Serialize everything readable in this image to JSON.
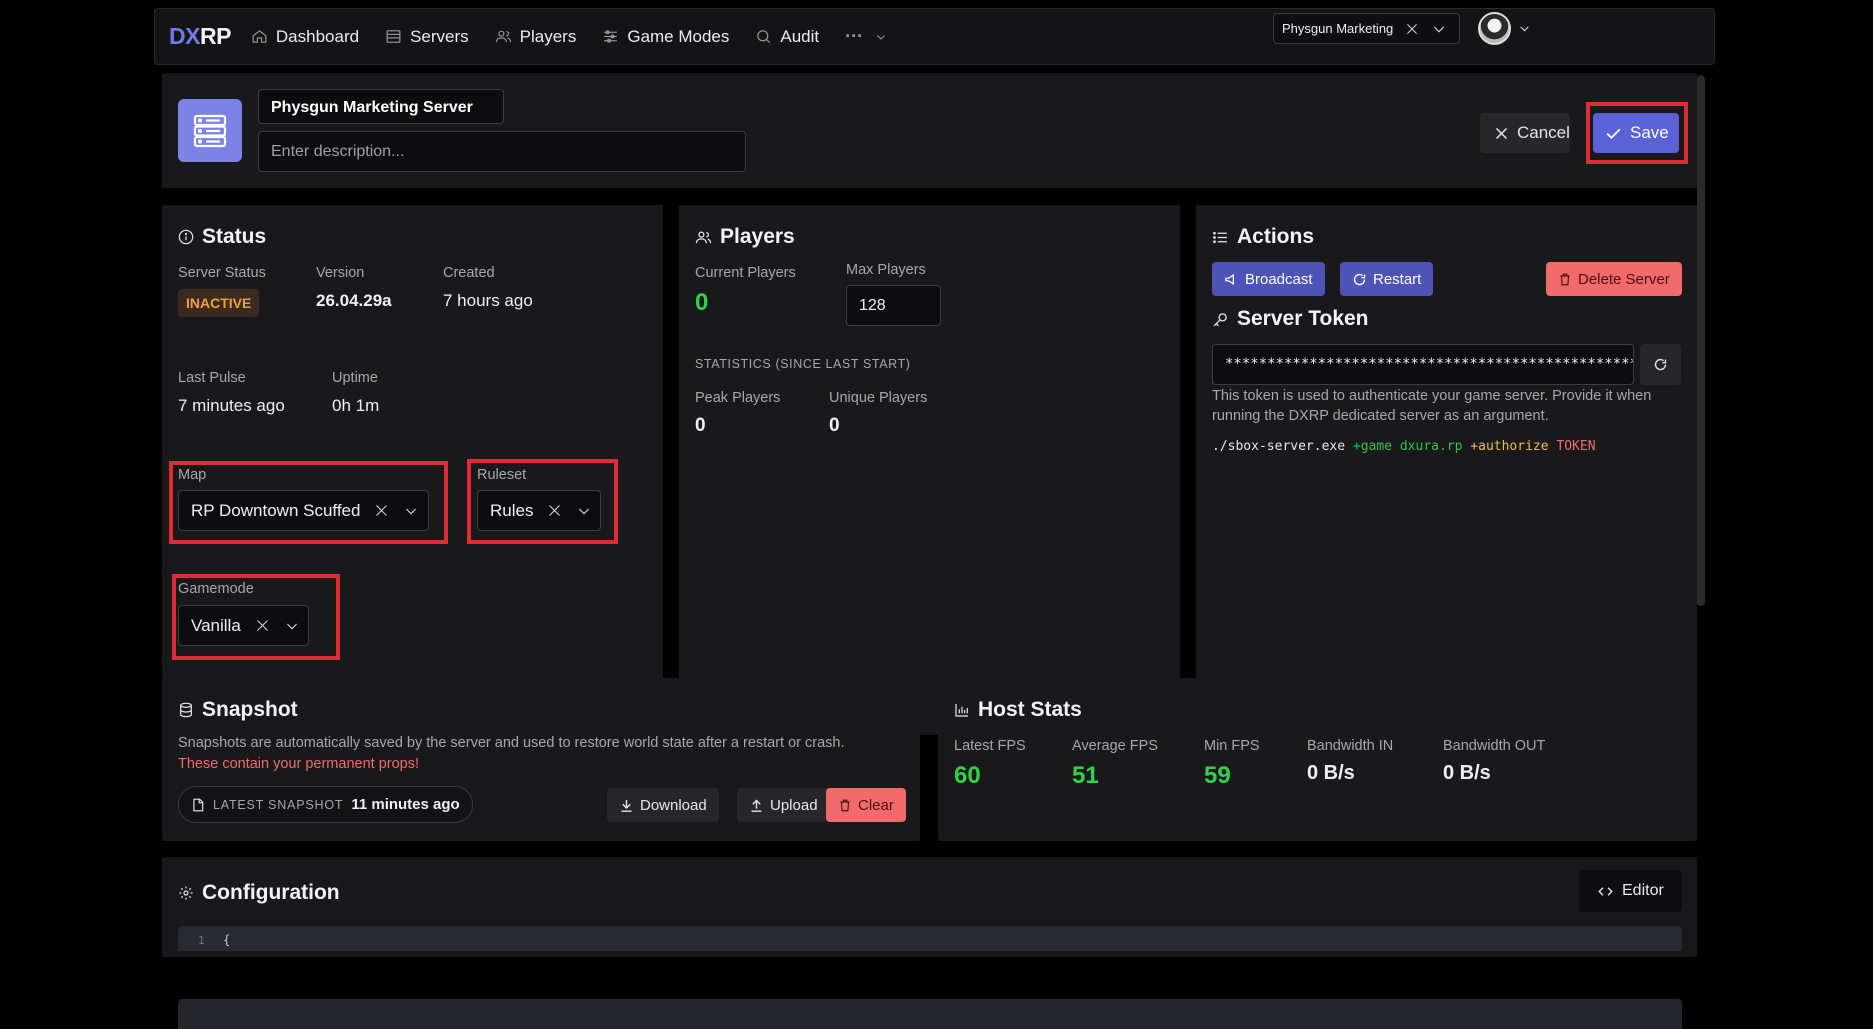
{
  "nav": {
    "logo_dx": "DX",
    "logo_rp": "RP",
    "items": [
      {
        "label": "Dashboard",
        "icon": "home-icon"
      },
      {
        "label": "Servers",
        "icon": "server-icon"
      },
      {
        "label": "Players",
        "icon": "users-icon"
      },
      {
        "label": "Game Modes",
        "icon": "sliders-icon"
      },
      {
        "label": "Audit",
        "icon": "search-icon"
      }
    ],
    "more": "···",
    "org_select": "Physgun Marketing"
  },
  "header": {
    "server_name": "Physgun Marketing Server",
    "description_placeholder": "Enter description...",
    "cancel": "Cancel",
    "save": "Save"
  },
  "status": {
    "title": "Status",
    "server_status_label": "Server Status",
    "server_status": "INACTIVE",
    "version_label": "Version",
    "version": "26.04.29a",
    "created_label": "Created",
    "created": "7 hours ago",
    "last_pulse_label": "Last Pulse",
    "last_pulse": "7 minutes ago",
    "uptime_label": "Uptime",
    "uptime": "0h 1m",
    "map_label": "Map",
    "map": "RP Downtown Scuffed",
    "ruleset_label": "Ruleset",
    "ruleset": "Rules",
    "gamemode_label": "Gamemode",
    "gamemode": "Vanilla"
  },
  "players": {
    "title": "Players",
    "current_label": "Current Players",
    "current": "0",
    "max_label": "Max Players",
    "max": "128",
    "stats_heading": "STATISTICS (SINCE LAST START)",
    "peak_label": "Peak Players",
    "peak": "0",
    "unique_label": "Unique Players",
    "unique": "0"
  },
  "actions": {
    "title": "Actions",
    "broadcast": "Broadcast",
    "restart": "Restart",
    "delete": "Delete Server",
    "token_title": "Server Token",
    "token": "****************************************************************",
    "token_help": "This token is used to authenticate your game server. Provide it when running the DXRP dedicated server as an argument.",
    "cmd_exe": "./sbox-server.exe",
    "cmd_game": "+game dxura.rp",
    "cmd_auth": "+authorize",
    "cmd_token": "TOKEN"
  },
  "snapshot": {
    "title": "Snapshot",
    "desc": "Snapshots are automatically saved by the server and used to restore world state after a restart or crash.",
    "warning": "These contain your permanent props!",
    "latest_label": "LATEST SNAPSHOT",
    "latest": "11 minutes ago",
    "download": "Download",
    "upload": "Upload",
    "clear": "Clear"
  },
  "host_stats": {
    "title": "Host Stats",
    "latest_fps_label": "Latest FPS",
    "latest_fps": "60",
    "avg_fps_label": "Average FPS",
    "avg_fps": "51",
    "min_fps_label": "Min FPS",
    "min_fps": "59",
    "bw_in_label": "Bandwidth IN",
    "bw_in": "0 B/s",
    "bw_out_label": "Bandwidth OUT",
    "bw_out": "0 B/s"
  },
  "config": {
    "title": "Configuration",
    "editor": "Editor",
    "line1_no": "1",
    "line1": "{"
  },
  "colors": {
    "accent": "#5b61d6",
    "success": "#33d14a",
    "danger": "#f26b6b",
    "warning": "#f0a040",
    "highlight": "#e02c34"
  }
}
